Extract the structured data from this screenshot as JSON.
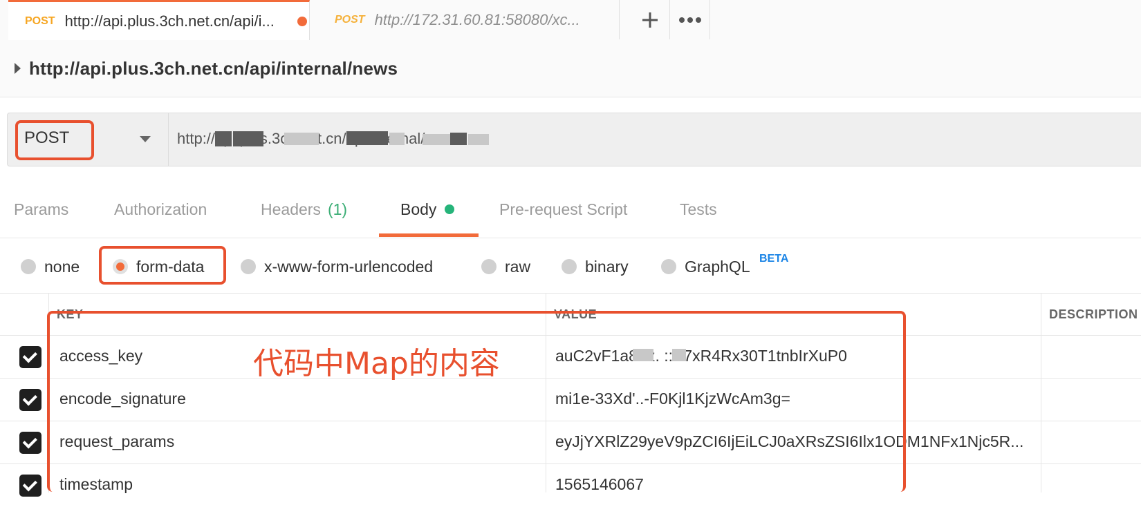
{
  "tabs": [
    {
      "method": "POST",
      "url": "http://api.plus.3ch.net.cn/api/i...",
      "unsaved": true,
      "active": true
    },
    {
      "method": "POST",
      "url": "http://172.31.60.81:58080/xc...",
      "unsaved": false,
      "active": false
    }
  ],
  "tab_actions": {
    "new_tab": "+",
    "more": "•••"
  },
  "breadcrumb": {
    "title": "http://api.plus.3ch.net.cn/api/internal/news"
  },
  "request": {
    "method": "POST",
    "url_visible": "http://api.plus.3ch.net.cn/api/internal/news"
  },
  "subtabs": [
    {
      "label": "Params"
    },
    {
      "label": "Authorization"
    },
    {
      "label": "Headers",
      "count": "(1)"
    },
    {
      "label": "Body",
      "active": true
    },
    {
      "label": "Pre-request Script"
    },
    {
      "label": "Tests"
    }
  ],
  "body_types": [
    {
      "label": "none",
      "checked": false
    },
    {
      "label": "form-data",
      "checked": true
    },
    {
      "label": "x-www-form-urlencoded",
      "checked": false
    },
    {
      "label": "raw",
      "checked": false
    },
    {
      "label": "binary",
      "checked": false
    },
    {
      "label": "GraphQL",
      "checked": false,
      "badge": "BETA"
    }
  ],
  "table": {
    "headers": {
      "key": "KEY",
      "value": "VALUE",
      "description": "DESCRIPTION"
    },
    "rows": [
      {
        "checked": true,
        "key": "access_key",
        "value": "auC2vF1a8 rz. ::V7xR4Rx30T1tnbIrXuP0"
      },
      {
        "checked": true,
        "key": "encode_signature",
        "value": "mi1e-33Xd'..-F0Kjl1KjzWcAm3g="
      },
      {
        "checked": true,
        "key": "request_params",
        "value": "eyJjYXRlZ29yeV9pZCI6IjEiLCJ0aXRsZSI6Ilx1ODM1NFx1Njc5R..."
      },
      {
        "checked": true,
        "key": "timestamp",
        "value": "1565146067"
      }
    ]
  },
  "annotation": {
    "text": "代码中Map的内容",
    "color": "#e8502e"
  },
  "colors": {
    "accent": "#f26b3a",
    "highlight": "#e8502e",
    "method": "#f6a623",
    "green": "#26b47a",
    "beta": "#1a84e6"
  }
}
